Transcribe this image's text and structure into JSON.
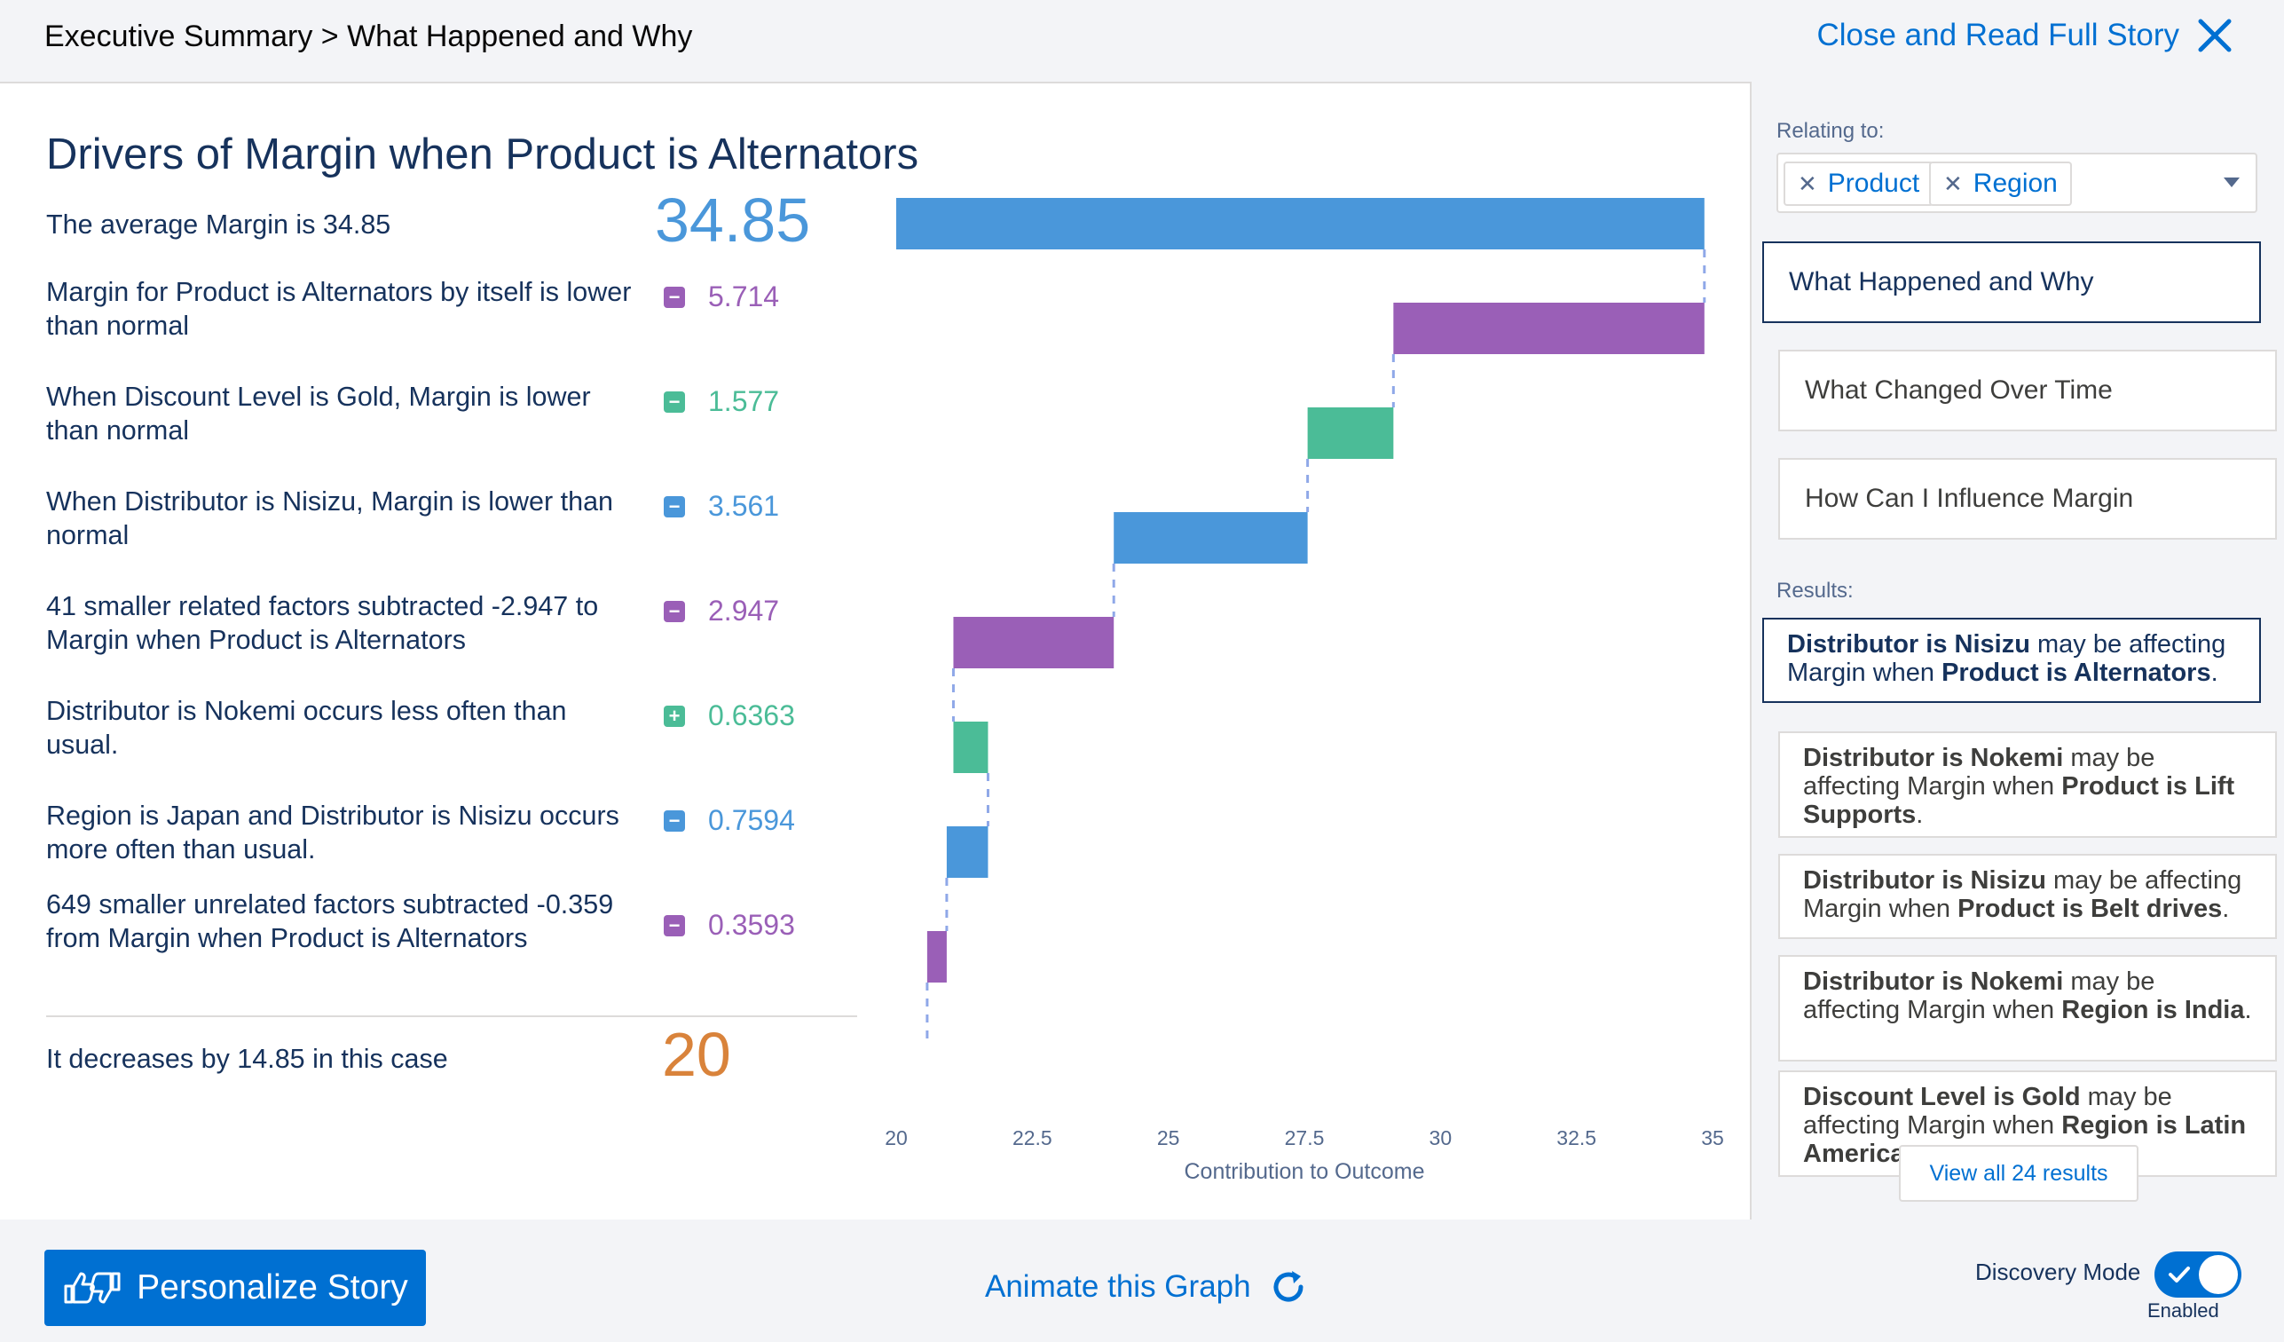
{
  "header": {
    "breadcrumb": "Executive Summary > What Happened and Why",
    "close_label": "Close and Read Full Story"
  },
  "main": {
    "title": "Drivers of Margin when Product is Alternators",
    "start": {
      "text": "The average Margin is 34.85",
      "value": "34.85"
    },
    "rows": [
      {
        "text": "Margin for Product is Alternators by itself is lower than normal",
        "sign": "minus",
        "value": "5.714",
        "color": "#9a5fb7"
      },
      {
        "text": "When Discount Level is Gold, Margin is lower than normal",
        "sign": "minus",
        "value": "1.577",
        "color": "#4bbc97"
      },
      {
        "text": "When Distributor is Nisizu, Margin is lower than normal",
        "sign": "minus",
        "value": "3.561",
        "color": "#4a97da"
      },
      {
        "text": "41 smaller related factors subtracted -2.947 to Margin when Product is Alternators",
        "sign": "minus",
        "value": "2.947",
        "color": "#9a5fb7"
      },
      {
        "text": "Distributor is Nokemi occurs less often than usual.",
        "sign": "plus",
        "value": "0.6363",
        "color": "#4bbc97"
      },
      {
        "text": "Region is Japan and Distributor is Nisizu occurs more often than usual.",
        "sign": "minus",
        "value": "0.7594",
        "color": "#4a97da"
      },
      {
        "text": "649 smaller unrelated factors subtracted -0.359 from Margin when Product is Alternators",
        "sign": "minus",
        "value": "0.3593",
        "color": "#9a5fb7"
      }
    ],
    "end": {
      "text": "It decreases by 14.85 in this case",
      "value": "20"
    }
  },
  "chart_data": {
    "type": "bar",
    "subtype": "waterfall",
    "orientation": "horizontal",
    "xlabel": "Contribution to Outcome",
    "xlim": [
      20,
      35
    ],
    "xticks": [
      "20",
      "22.5",
      "25",
      "27.5",
      "30",
      "32.5",
      "35"
    ],
    "bars": [
      {
        "label": "The average Margin is 34.85",
        "start": 20,
        "end": 34.85,
        "color": "#4a97da"
      },
      {
        "label": "Margin for Product is Alternators by itself is lower than normal",
        "start": 34.85,
        "end": 29.136,
        "color": "#9a5fb7"
      },
      {
        "label": "When Discount Level is Gold, Margin is lower than normal",
        "start": 29.136,
        "end": 27.559,
        "color": "#4bbc97"
      },
      {
        "label": "When Distributor is Nisizu, Margin is lower than normal",
        "start": 27.559,
        "end": 23.998,
        "color": "#4a97da"
      },
      {
        "label": "41 smaller related factors subtracted -2.947 to Margin when Product is Alternators",
        "start": 23.998,
        "end": 21.051,
        "color": "#9a5fb7"
      },
      {
        "label": "Distributor is Nokemi occurs less often than usual.",
        "start": 21.051,
        "end": 21.687,
        "color": "#4bbc97"
      },
      {
        "label": "Region is Japan and Distributor is Nisizu occurs more often than usual.",
        "start": 21.687,
        "end": 20.928,
        "color": "#4a97da"
      },
      {
        "label": "649 smaller unrelated factors subtracted -0.359 from Margin when Product is Alternators",
        "start": 20.928,
        "end": 20.569,
        "color": "#9a5fb7"
      }
    ],
    "final_value": 20
  },
  "colors": {
    "blue": "#4a97da",
    "purple": "#9a5fb7",
    "green": "#4bbc97",
    "orange": "#d9833b",
    "accent": "#0070d2"
  },
  "sidebar": {
    "relating_label": "Relating to:",
    "pills": [
      "Product",
      "Region"
    ],
    "nav": [
      "What Happened and Why",
      "What Changed Over Time",
      "How Can I Influence Margin"
    ],
    "results_label": "Results:",
    "results": [
      {
        "parts": [
          [
            "b",
            "Distributor is Nisizu"
          ],
          [
            "t",
            " may be affecting Margin when "
          ],
          [
            "b",
            "Product is Alternators"
          ],
          [
            "t",
            "."
          ]
        ]
      },
      {
        "parts": [
          [
            "b",
            "Distributor is Nokemi"
          ],
          [
            "t",
            " may be affecting Margin when "
          ],
          [
            "b",
            "Product is Lift Supports"
          ],
          [
            "t",
            "."
          ]
        ]
      },
      {
        "parts": [
          [
            "b",
            "Distributor is Nisizu"
          ],
          [
            "t",
            " may be affecting Margin when "
          ],
          [
            "b",
            "Product is Belt drives"
          ],
          [
            "t",
            "."
          ]
        ]
      },
      {
        "parts": [
          [
            "b",
            "Distributor is Nokemi"
          ],
          [
            "t",
            " may be affecting Margin when "
          ],
          [
            "b",
            "Region is India"
          ],
          [
            "t",
            "."
          ]
        ]
      },
      {
        "parts": [
          [
            "b",
            "Discount Level is Gold"
          ],
          [
            "t",
            " may be affecting Margin when "
          ],
          [
            "b",
            "Region is Latin America"
          ],
          [
            "t",
            "."
          ]
        ]
      }
    ],
    "view_all": "View all 24 results"
  },
  "footer": {
    "personalize_label": "Personalize Story",
    "animate_label": "Animate this Graph",
    "discovery_label": "Discovery Mode",
    "discovery_state": "Enabled"
  }
}
